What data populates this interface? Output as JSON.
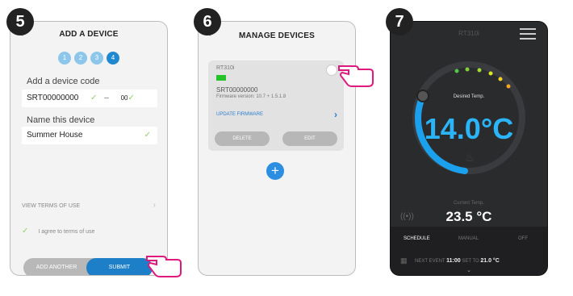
{
  "screen5": {
    "step": "5",
    "title": "ADD A DEVICE",
    "steps": [
      "1",
      "2",
      "3",
      "4"
    ],
    "code_label": "Add a device code",
    "code_value": "SRT00000000",
    "code_suffix": "00",
    "name_label": "Name this device",
    "name_value": "Summer House",
    "terms_link": "VIEW TERMS OF USE",
    "agree_text": "I agree to terms of use",
    "add_another": "ADD ANOTHER",
    "submit": "SUBMIT"
  },
  "screen6": {
    "step": "6",
    "title": "MANAGE DEVICES",
    "device_name": "RT310i",
    "serial": "SRT00000000",
    "firmware": "Firmware version: 10.7 + 1.5.1.8",
    "update": "UPDATE FIRMWARE",
    "delete": "DELETE",
    "edit": "EDIT",
    "add": "+"
  },
  "screen7": {
    "step": "7",
    "device": "RT310i",
    "desired_label": "Desired Temp.",
    "desired_temp": "14.0°C",
    "current_label": "Current Temp.",
    "current_temp": "23.5 °C",
    "tabs": [
      "SCHEDULE",
      "MANUAL",
      "OFF"
    ],
    "next_prefix": "NEXT EVENT",
    "next_time": "11:00",
    "next_mid": "SET TO",
    "next_temp": "21.0 °C"
  }
}
